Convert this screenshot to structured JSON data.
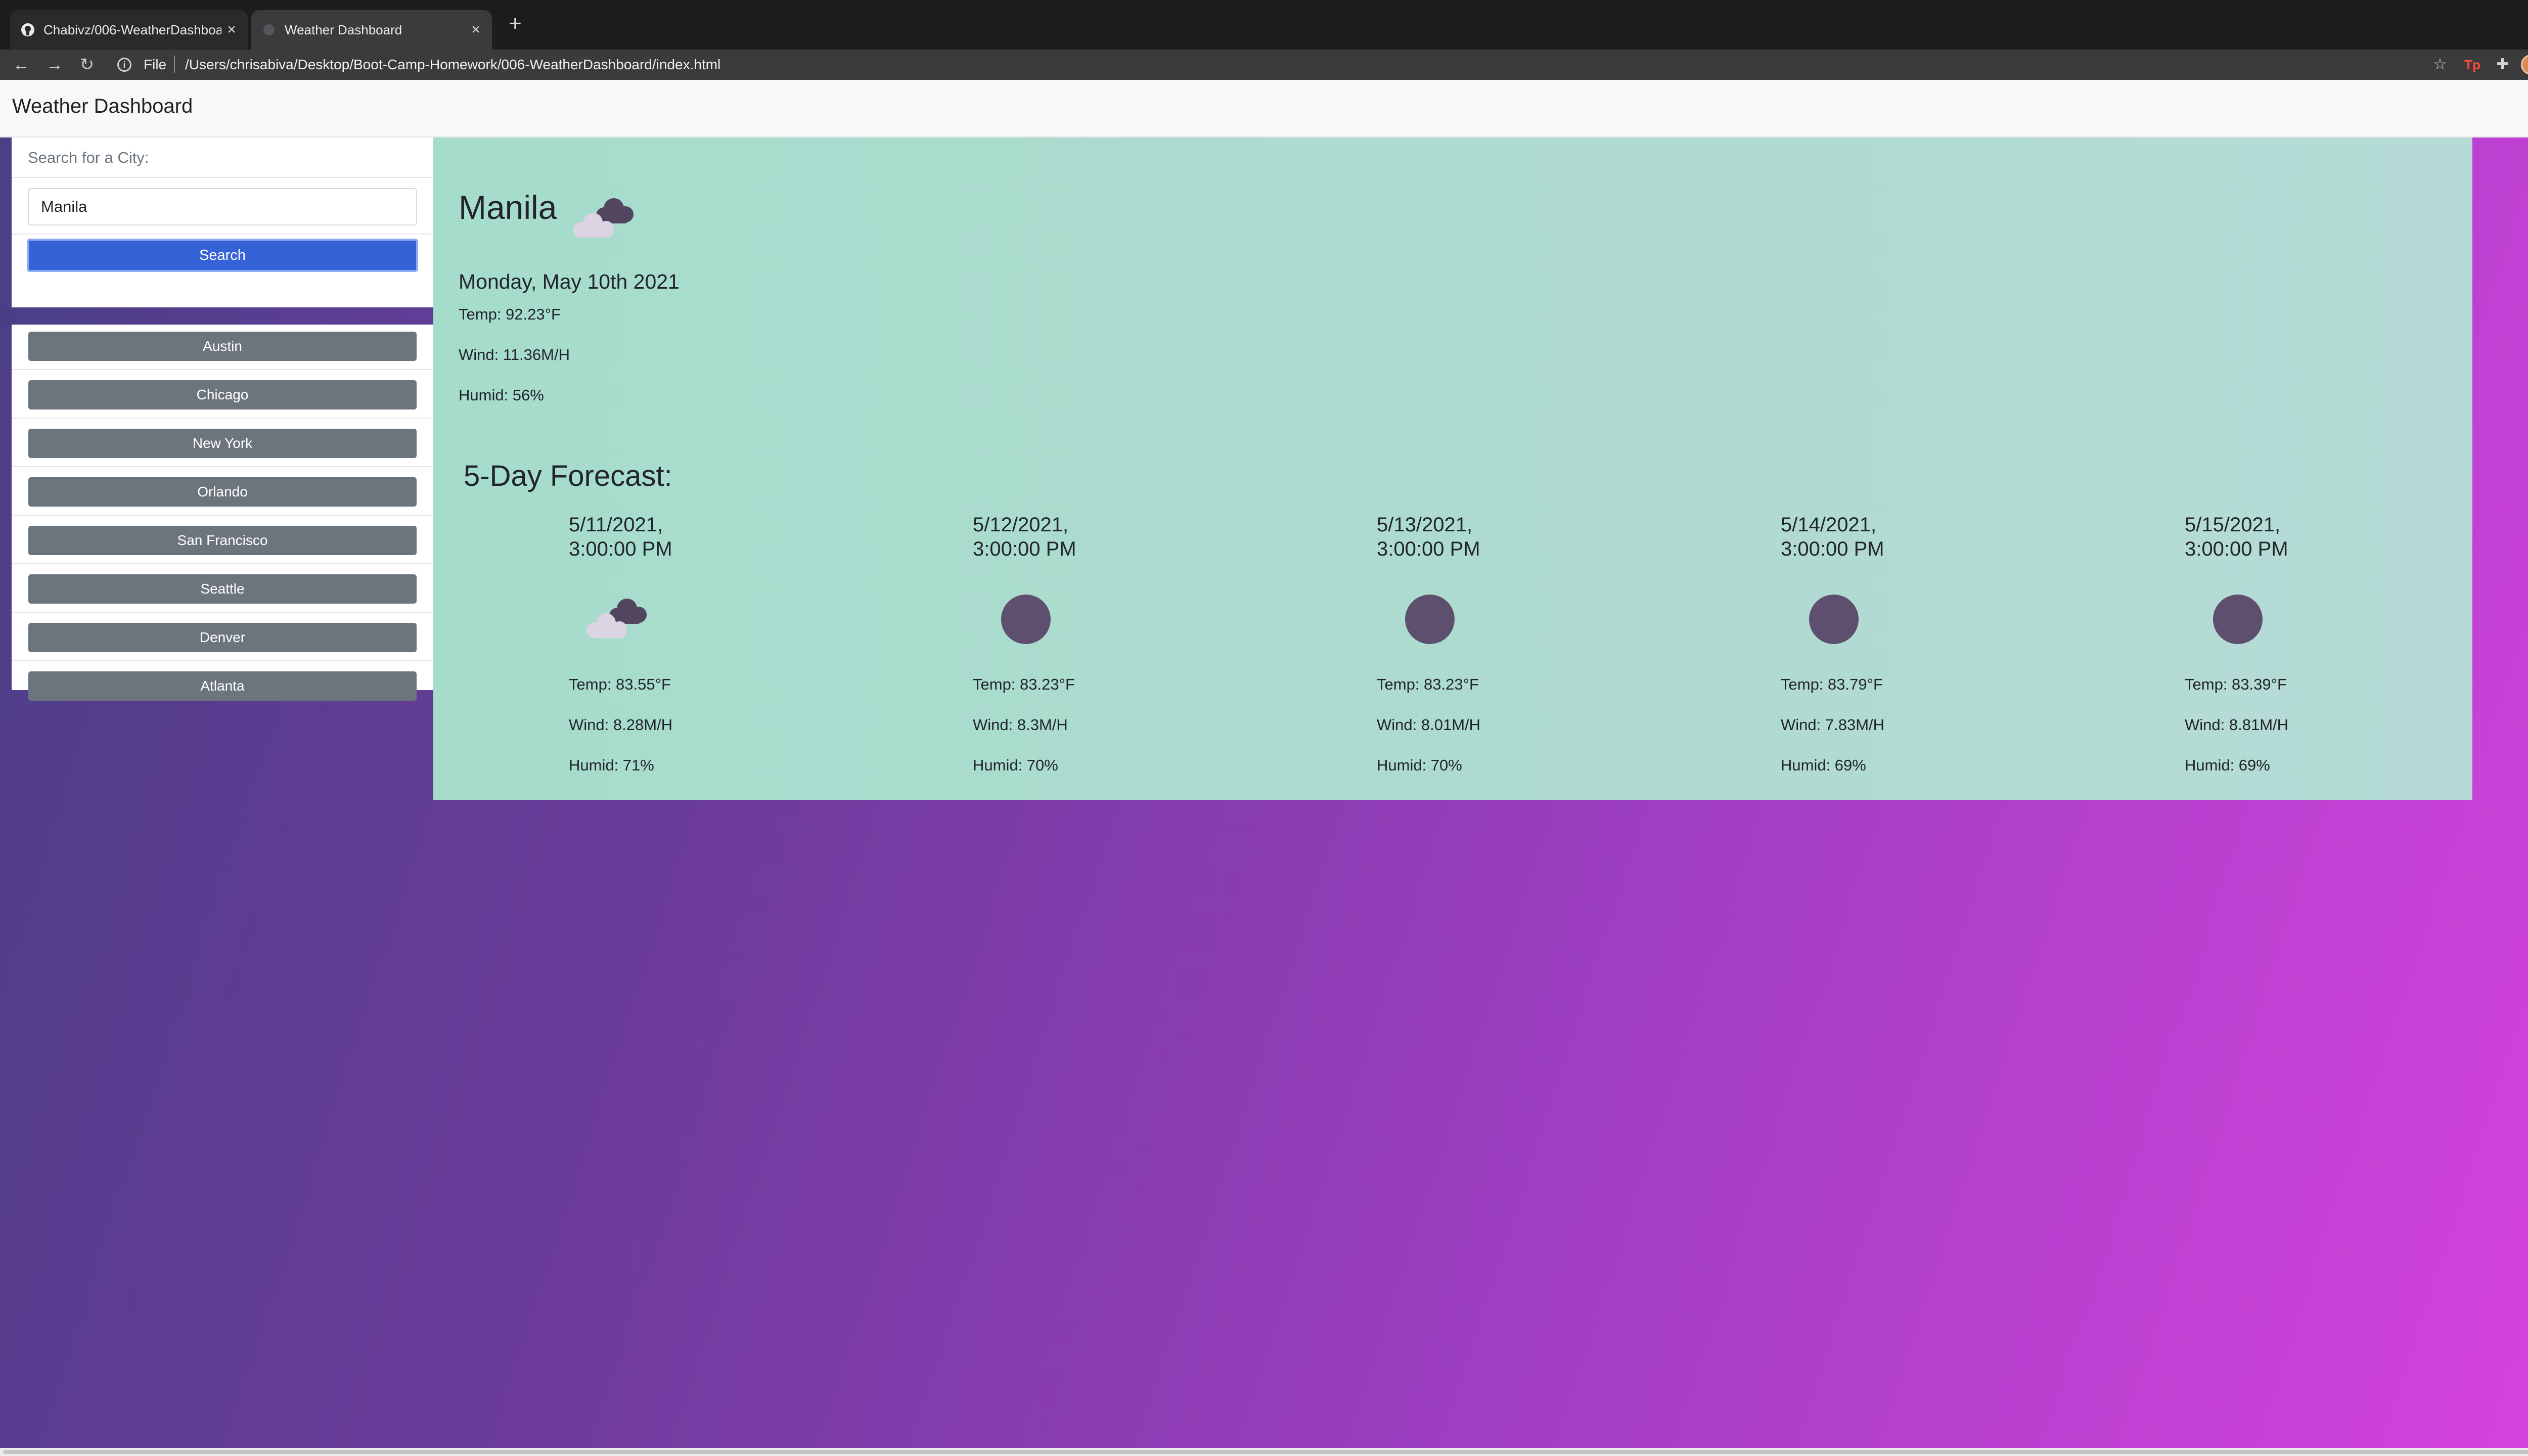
{
  "browser": {
    "tabs": [
      {
        "title": "Chabivz/006-WeatherDashboard",
        "icon": "github-icon"
      },
      {
        "title": "Weather Dashboard",
        "icon": "page-icon"
      }
    ],
    "url_scheme": "File",
    "url": "/Users/chrisabiva/Desktop/Boot-Camp-Homework/006-WeatherDashboard/index.html"
  },
  "header": {
    "title": "Weather Dashboard"
  },
  "search": {
    "label": "Search for a City:",
    "value": "Manila",
    "button_label": "Search"
  },
  "history": [
    "Austin",
    "Chicago",
    "New York",
    "Orlando",
    "San Francisco",
    "Seattle",
    "Denver",
    "Atlanta"
  ],
  "current": {
    "city": "Manila",
    "icon": "cloudy-icon",
    "date": "Monday, May 10th 2021",
    "temp": "Temp: 92.23°F",
    "wind": "Wind: 11.36M/H",
    "humid": "Humid: 56%"
  },
  "forecast": {
    "title": "5-Day Forecast:",
    "days": [
      {
        "date_line1": "5/11/2021,",
        "date_line2": "3:00:00 PM",
        "icon": "cloudy-icon",
        "temp": "Temp: 83.55°F",
        "wind": "Wind: 8.28M/H",
        "humid": "Humid: 71%"
      },
      {
        "date_line1": "5/12/2021,",
        "date_line2": "3:00:00 PM",
        "icon": "rain-icon",
        "temp": "Temp: 83.23°F",
        "wind": "Wind: 8.3M/H",
        "humid": "Humid: 70%"
      },
      {
        "date_line1": "5/13/2021,",
        "date_line2": "3:00:00 PM",
        "icon": "rain-icon",
        "temp": "Temp: 83.23°F",
        "wind": "Wind: 8.01M/H",
        "humid": "Humid: 70%"
      },
      {
        "date_line1": "5/14/2021,",
        "date_line2": "3:00:00 PM",
        "icon": "rain-icon",
        "temp": "Temp: 83.79°F",
        "wind": "Wind: 7.83M/H",
        "humid": "Humid: 69%"
      },
      {
        "date_line1": "5/15/2021,",
        "date_line2": "3:00:00 PM",
        "icon": "rain-icon",
        "temp": "Temp: 83.39°F",
        "wind": "Wind: 8.81M/H",
        "humid": "Humid: 69%"
      }
    ]
  },
  "colors": {
    "accent": "#3662d8",
    "history_button": "#6c757d",
    "card_bg": "#aedbd0",
    "gradient_start": "#4a3f86",
    "gradient_end": "#d743de"
  }
}
